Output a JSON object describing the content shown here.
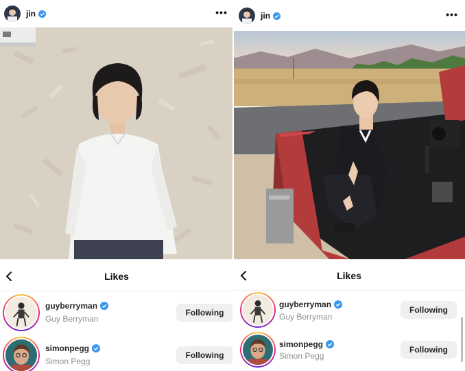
{
  "posts": [
    {
      "author": "jin",
      "more_icon": "more-horizontal-icon",
      "likes_title": "Likes",
      "likers": [
        {
          "handle": "guyberryman",
          "name": "Guy Berryman",
          "button": "Following"
        },
        {
          "handle": "simonpegg",
          "name": "Simon Pegg",
          "button": "Following"
        }
      ]
    },
    {
      "author": "jin",
      "more_icon": "more-horizontal-icon",
      "likes_title": "Likes",
      "likers": [
        {
          "handle": "guyberryman",
          "name": "Guy Berryman",
          "button": "Following"
        },
        {
          "handle": "simonpegg",
          "name": "Simon Pegg",
          "button": "Following"
        }
      ]
    }
  ],
  "colors": {
    "verified": "#3897f0",
    "button_bg": "#efefef",
    "secondary_text": "#8e8e8e"
  }
}
